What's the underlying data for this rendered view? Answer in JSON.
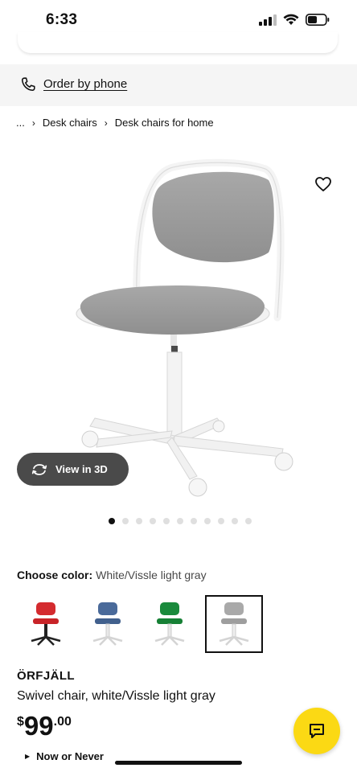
{
  "status_bar": {
    "time": "6:33"
  },
  "order_by_phone": {
    "label": "Order by phone"
  },
  "breadcrumb": {
    "ellipsis": "...",
    "items": [
      "Desk chairs",
      "Desk chairs for home"
    ]
  },
  "product_image": {
    "view_3d_label": "View in 3D",
    "carousel_count": 11,
    "carousel_active": 0
  },
  "color_picker": {
    "heading": "Choose color:",
    "selected_value": "White/Vissle light gray",
    "swatches": [
      {
        "color": "#d42b2f"
      },
      {
        "color": "#4a6a9a"
      },
      {
        "color": "#1a8a3c"
      },
      {
        "color": "#a9a9a9"
      }
    ],
    "selected_index": 3
  },
  "product": {
    "name": "ÖRFJÄLL",
    "description": "Swivel chair, white/Vissle light gray",
    "price_currency": "$",
    "price_main": "99",
    "price_cents": ".00",
    "badge": "Now or Never"
  },
  "colors": {
    "accent_yellow": "#fbd914",
    "text": "#111111",
    "band": "#f5f5f5"
  }
}
